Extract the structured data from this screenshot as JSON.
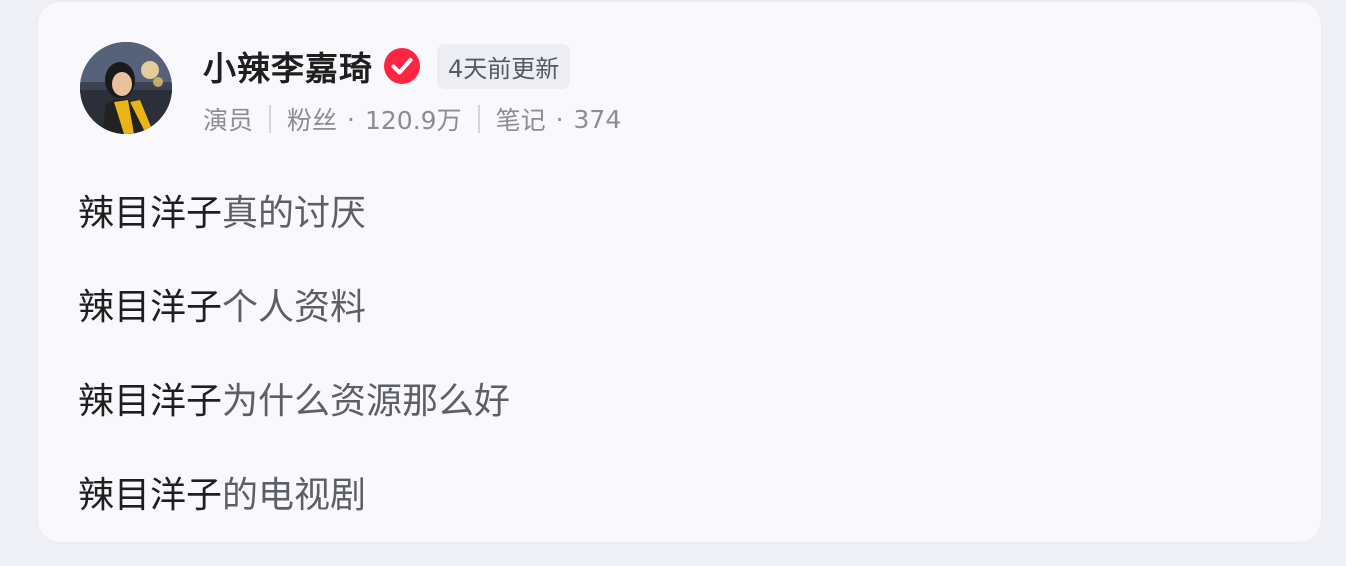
{
  "profile": {
    "name": "小辣李嘉琦",
    "verified_icon": "verified-check-icon",
    "verified_color": "#ff2442",
    "update_badge": "4天前更新",
    "role": "演员",
    "followers_label": "粉丝",
    "followers_value": "120.9万",
    "notes_label": "笔记",
    "notes_value": "374",
    "dot": "·"
  },
  "suggestions": [
    {
      "keyword": "辣目洋子",
      "suffix": "真的讨厌"
    },
    {
      "keyword": "辣目洋子",
      "suffix": "个人资料"
    },
    {
      "keyword": "辣目洋子",
      "suffix": "为什么资源那么好"
    },
    {
      "keyword": "辣目洋子",
      "suffix": "的电视剧"
    }
  ]
}
